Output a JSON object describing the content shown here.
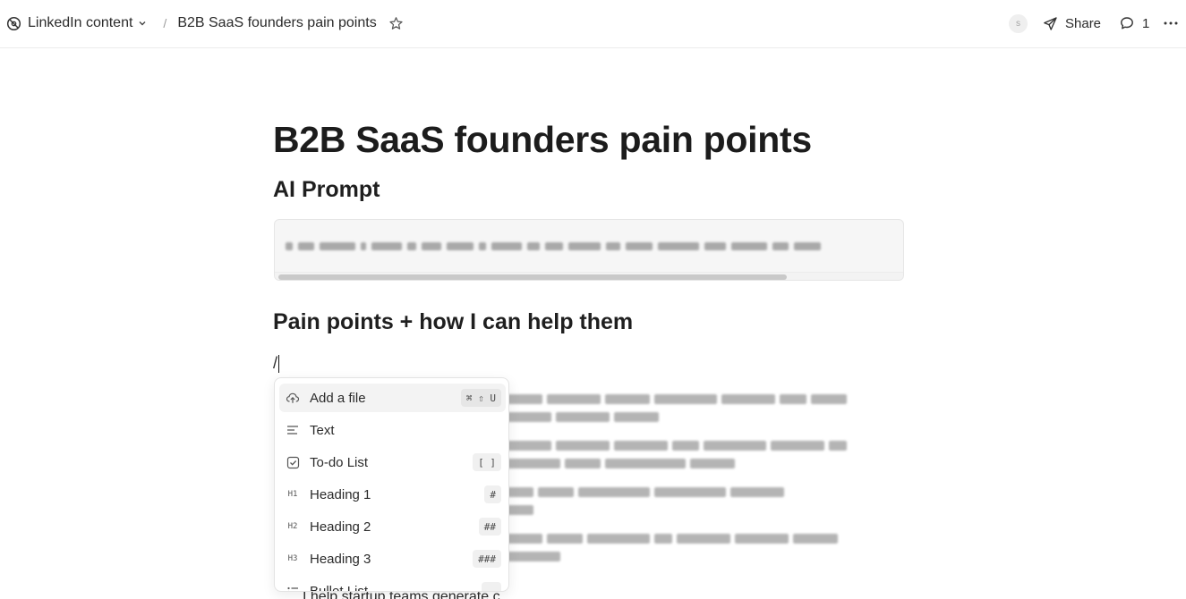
{
  "header": {
    "workspace": "LinkedIn content",
    "separator": "/",
    "page": "B2B SaaS founders pain points",
    "avatar_initial": "s",
    "share_label": "Share",
    "comment_count": "1"
  },
  "doc": {
    "title": "B2B SaaS founders pain points",
    "section1": "AI Prompt",
    "section2": "Pain points + how I can help them",
    "slash": "/",
    "tail_text": "I help startup teams generate c"
  },
  "menu": {
    "items": [
      {
        "label": "Add a file",
        "icon": "upload-cloud-icon",
        "shortcut": "⌘ ⇧ U"
      },
      {
        "label": "Text",
        "icon": "text-align-icon",
        "shortcut": ""
      },
      {
        "label": "To-do List",
        "icon": "checkbox-icon",
        "shortcut": "[ ]"
      },
      {
        "label": "Heading 1",
        "icon": "H1",
        "shortcut": "#"
      },
      {
        "label": "Heading 2",
        "icon": "H2",
        "shortcut": "##"
      },
      {
        "label": "Heading 3",
        "icon": "H3",
        "shortcut": "###"
      },
      {
        "label": "Bullet List",
        "icon": "bullet-list-icon",
        "shortcut": ""
      }
    ]
  }
}
